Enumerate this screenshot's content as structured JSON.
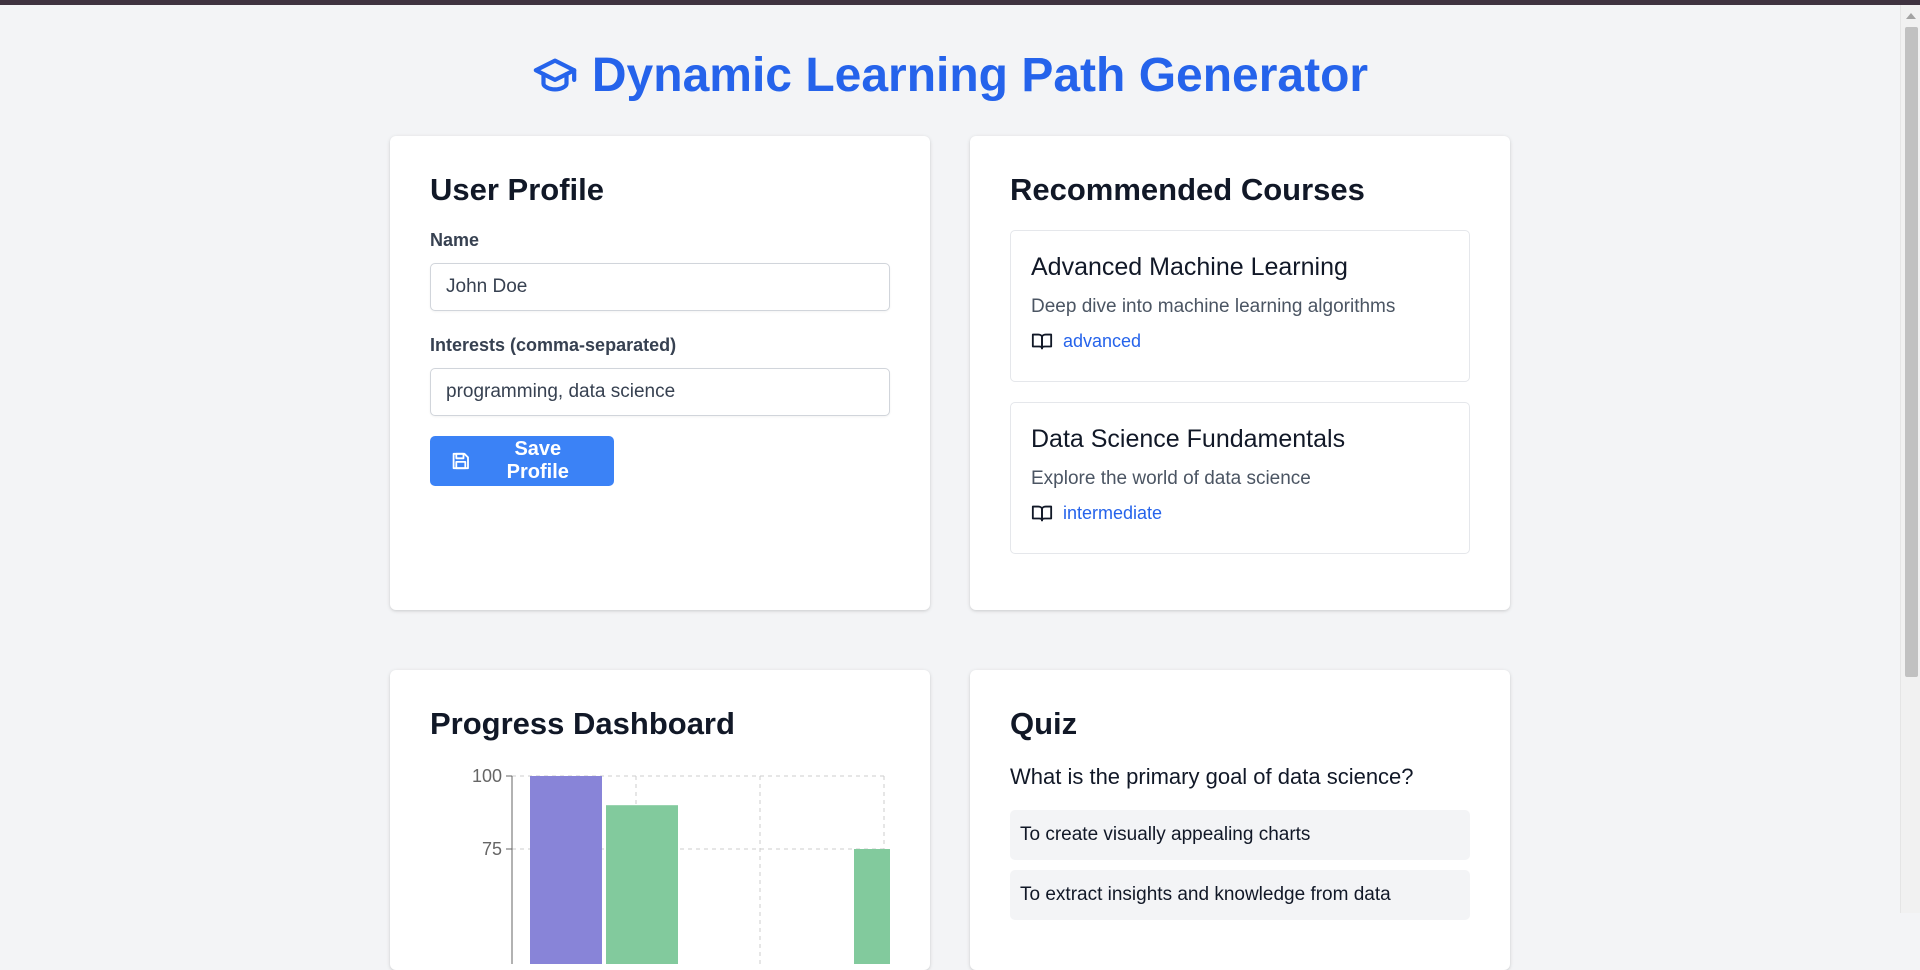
{
  "app": {
    "title": "Dynamic Learning Path Generator",
    "title_icon": "graduation-cap-icon",
    "accent_color": "#2563eb"
  },
  "profile": {
    "heading": "User Profile",
    "name_label": "Name",
    "name_value": "John Doe",
    "interests_label": "Interests (comma-separated)",
    "interests_value": "programming, data science",
    "save_label": "Save Profile",
    "save_icon": "save-icon"
  },
  "courses": {
    "heading": "Recommended Courses",
    "items": [
      {
        "title": "Advanced Machine Learning",
        "description": "Deep dive into machine learning algorithms",
        "level": "advanced",
        "icon": "book-icon"
      },
      {
        "title": "Data Science Fundamentals",
        "description": "Explore the world of data science",
        "level": "intermediate",
        "icon": "book-icon"
      }
    ]
  },
  "progress": {
    "heading": "Progress Dashboard"
  },
  "chart_data": {
    "type": "bar",
    "ylim": [
      0,
      100
    ],
    "y_ticks": [
      100,
      75
    ],
    "grid": true,
    "series": [
      {
        "color": "#8884d8",
        "values": [
          100,
          null,
          null
        ]
      },
      {
        "color": "#82ca9d",
        "values": [
          90,
          null,
          75
        ]
      }
    ]
  },
  "quiz": {
    "heading": "Quiz",
    "question": "What is the primary goal of data science?",
    "options": [
      "To create visually appealing charts",
      "To extract insights and knowledge from data"
    ]
  }
}
